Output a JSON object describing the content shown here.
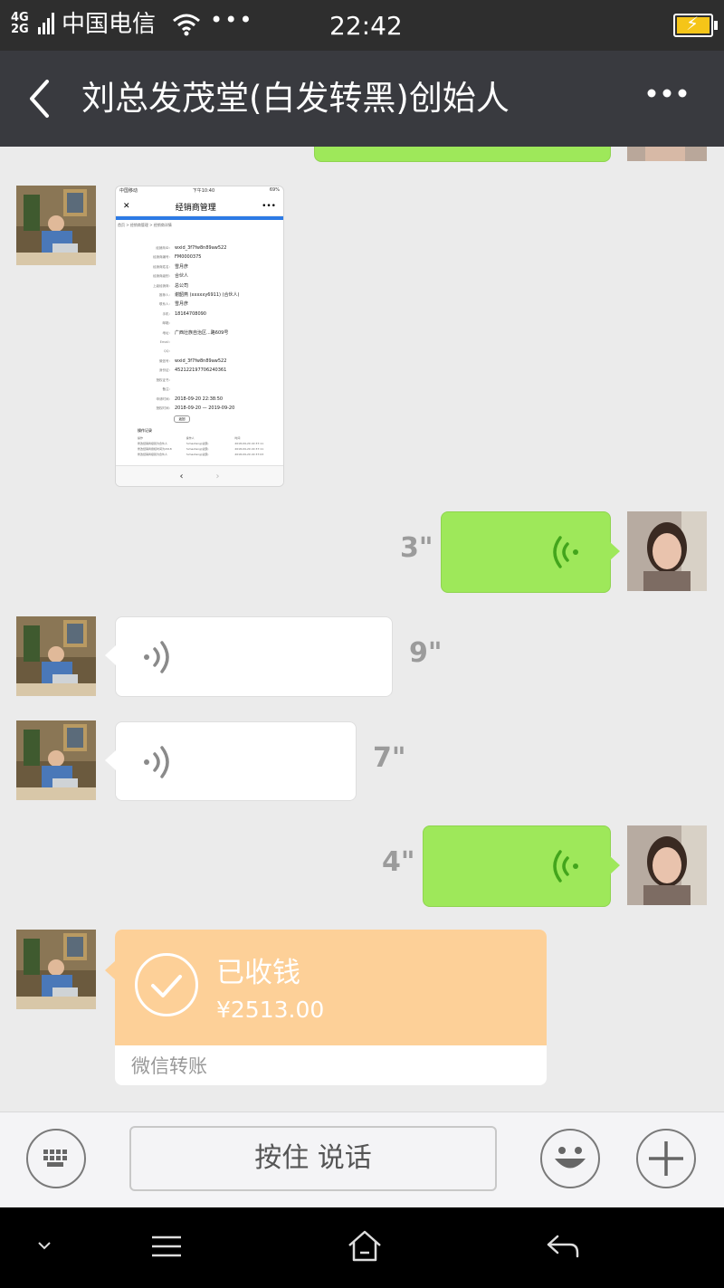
{
  "status_bar": {
    "network": "4G\n2G",
    "carrier": "中国电信",
    "more": "•••",
    "time": "22:42"
  },
  "header": {
    "title": "刘总发茂堂(白发转黑)创始人"
  },
  "messages": {
    "voice_out_1": {
      "duration": "3\""
    },
    "voice_in_1": {
      "duration": "9\""
    },
    "voice_in_2": {
      "duration": "7\""
    },
    "voice_out_2": {
      "duration": "4\""
    },
    "transfer": {
      "status": "已收钱",
      "amount": "¥2513.00",
      "label": "微信转账"
    },
    "screenshot": {
      "status_left": "中国移动",
      "status_time": "下午10:40",
      "status_right": "69%",
      "title": "经销商管理",
      "close": "✕",
      "menu": "•••",
      "breadcrumb": "首页 > 经销商管理 > 经销商详情",
      "rows": [
        {
          "k": "经销商ID：",
          "v": "wxid_3f7fw8n89aw522"
        },
        {
          "k": "经销商编号：",
          "v": "FM0000375"
        },
        {
          "k": "经销商姓名：",
          "v": "雪月彦"
        },
        {
          "k": "经销商级别：",
          "v": "合伙人"
        },
        {
          "k": "上级经销商：",
          "v": "总公司"
        },
        {
          "k": "推荐人：",
          "v": "谢韶燕 (xxxxxy6911) (合伙人)"
        },
        {
          "k": "联系人：",
          "v": "雪月彦"
        },
        {
          "k": "手机：",
          "v": "18164708090"
        },
        {
          "k": "邮箱：",
          "v": ""
        },
        {
          "k": "地址：",
          "v": "广西壮族自治区...路609号"
        },
        {
          "k": "Email：",
          "v": ""
        },
        {
          "k": "QQ：",
          "v": ""
        },
        {
          "k": "微信号：",
          "v": "wxid_3f7fw8n89aw522"
        },
        {
          "k": "身份证：",
          "v": "452122197706240361"
        },
        {
          "k": "授权证书：",
          "v": ""
        },
        {
          "k": "备注：",
          "v": ""
        },
        {
          "k": "申请时间：",
          "v": "2018-09-20 22:38:50"
        },
        {
          "k": "授权时间：",
          "v": "2018-09-20 — 2019-09-20"
        }
      ],
      "button": "返回",
      "log_title": "操作记录",
      "logs": [
        [
          "操作",
          "操作人",
          "时间"
        ],
        [
          "修改经销商级别为合伙人",
          "fumaotang(总部)",
          "2018-09-20 22:37:11"
        ],
        [
          "修改经销商授权时间为2018",
          "fumaotang(总部)",
          "2018-09-20 22:37:11"
        ],
        [
          "修改经销商级别为合伙人",
          "fumaotang(总部)",
          "2018-09-20 22:37:03"
        ]
      ],
      "nav_back": "‹",
      "nav_forward": "›"
    }
  },
  "input_bar": {
    "hold_to_talk": "按住 说话"
  },
  "icons": {
    "back": "chevron-left-icon",
    "more": "more-icon",
    "keyboard": "keyboard-icon",
    "emoji": "emoji-icon",
    "plus": "plus-icon"
  },
  "colors": {
    "title_bar": "#393a3f",
    "sent_bubble": "#9ee85a",
    "transfer_top": "#fdd098",
    "chat_bg": "#ebebeb"
  }
}
